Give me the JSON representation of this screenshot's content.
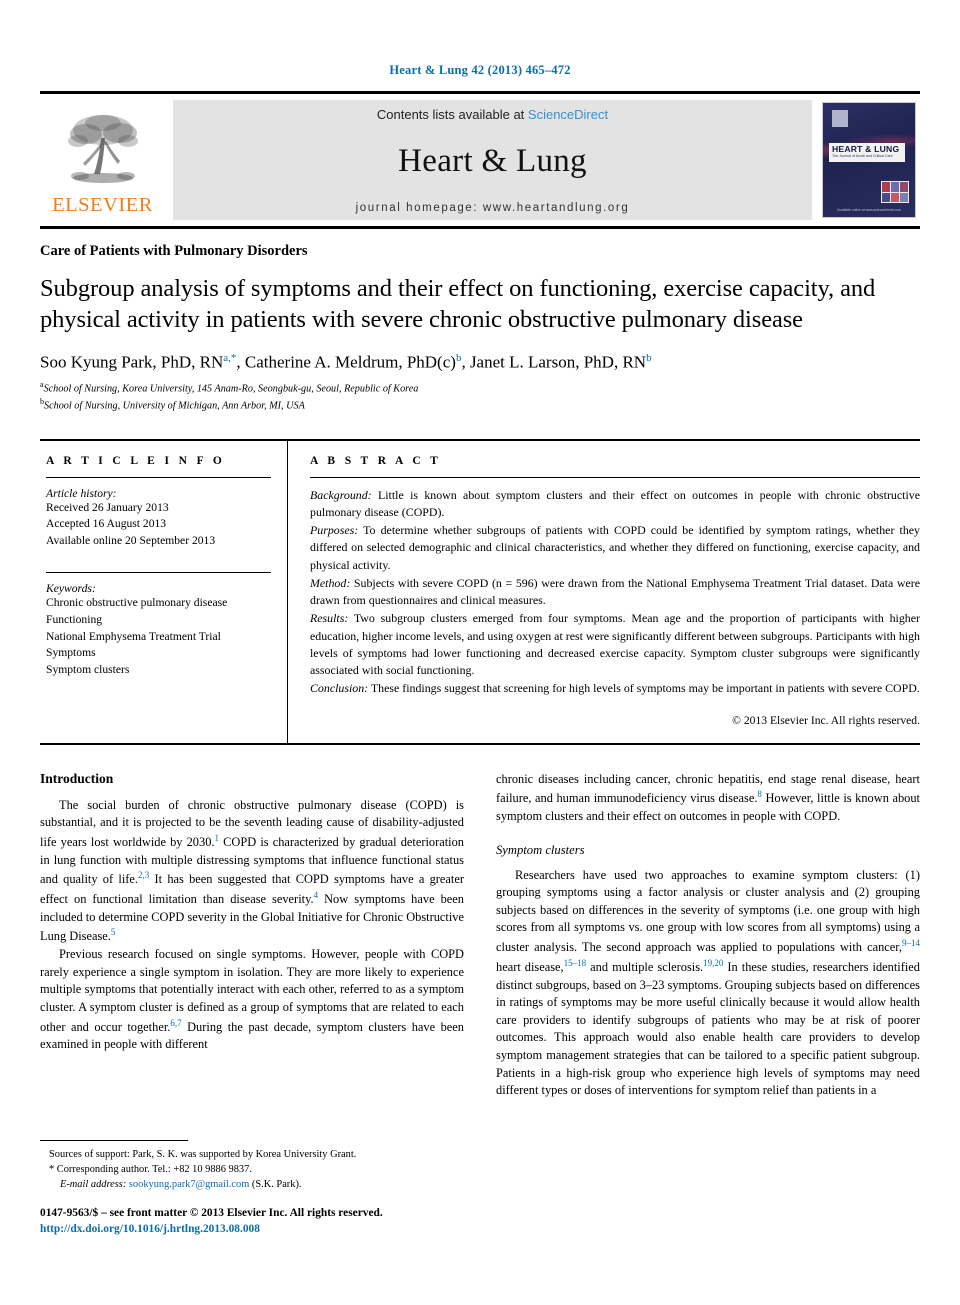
{
  "running_head": "Heart & Lung 42 (2013) 465–472",
  "masthead": {
    "publisher_name": "ELSEVIER",
    "contents_prefix": "Contents lists available at ",
    "sciencedirect": "ScienceDirect",
    "journal_title": "Heart & Lung",
    "homepage": "journal homepage: www.heartandlung.org",
    "cover": {
      "title": "HEART & LUNG",
      "subtitle": "The Journal of Acute and Critical Care",
      "footer": "Available online at www.sciencedirect.com"
    }
  },
  "section_label": "Care of Patients with Pulmonary Disorders",
  "article_title": "Subgroup analysis of symptoms and their effect on functioning, exercise capacity, and physical activity in patients with severe chronic obstructive pulmonary disease",
  "authors": [
    {
      "name": "Soo Kyung Park, PhD, RN",
      "marks": "a,*"
    },
    {
      "name": "Catherine A. Meldrum, PhD(c)",
      "marks": "b"
    },
    {
      "name": "Janet L. Larson, PhD, RN",
      "marks": "b"
    }
  ],
  "affiliations": [
    {
      "mark": "a",
      "text": "School of Nursing, Korea University, 145 Anam-Ro, Seongbuk-gu, Seoul, Republic of Korea"
    },
    {
      "mark": "b",
      "text": "School of Nursing, University of Michigan, Ann Arbor, MI, USA"
    }
  ],
  "article_info": {
    "heading": "A R T I C L E  I N F O",
    "history_label": "Article history:",
    "history": [
      "Received 26 January 2013",
      "Accepted 16 August 2013",
      "Available online 20 September 2013"
    ],
    "keywords_label": "Keywords:",
    "keywords": [
      "Chronic obstructive pulmonary disease",
      "Functioning",
      "National Emphysema Treatment Trial",
      "Symptoms",
      "Symptom clusters"
    ]
  },
  "abstract": {
    "heading": "A B S T R A C T",
    "sections": [
      {
        "label": "Background:",
        "text": " Little is known about symptom clusters and their effect on outcomes in people with chronic obstructive pulmonary disease (COPD)."
      },
      {
        "label": "Purposes:",
        "text": " To determine whether subgroups of patients with COPD could be identified by symptom ratings, whether they differed on selected demographic and clinical characteristics, and whether they differed on functioning, exercise capacity, and physical activity."
      },
      {
        "label": "Method:",
        "text": " Subjects with severe COPD (n = 596) were drawn from the National Emphysema Treatment Trial dataset. Data were drawn from questionnaires and clinical measures."
      },
      {
        "label": "Results:",
        "text": " Two subgroup clusters emerged from four symptoms. Mean age and the proportion of participants with higher education, higher income levels, and using oxygen at rest were significantly different between subgroups. Participants with high levels of symptoms had lower functioning and decreased exercise capacity. Symptom cluster subgroups were significantly associated with social functioning."
      },
      {
        "label": "Conclusion:",
        "text": " These findings suggest that screening for high levels of symptoms may be important in patients with severe COPD."
      }
    ],
    "copyright": "© 2013 Elsevier Inc. All rights reserved."
  },
  "body": {
    "left_column": {
      "heading": "Introduction",
      "paragraph1_a": "The social burden of chronic obstructive pulmonary disease (COPD) is substantial, and it is projected to be the seventh leading cause of disability-adjusted life years lost worldwide by 2030.",
      "ref1": "1",
      "paragraph1_b": " COPD is characterized by gradual deterioration in lung function with multiple distressing symptoms that influence functional status and quality of life.",
      "ref2": "2,3",
      "paragraph1_c": " It has been suggested that COPD symptoms have a greater effect on functional limitation than disease severity.",
      "ref3": "4",
      "paragraph1_d": " Now symptoms have been included to determine COPD severity in the Global Initiative for Chronic Obstructive Lung Disease.",
      "ref4": "5",
      "paragraph2_a": "Previous research focused on single symptoms. However, people with COPD rarely experience a single symptom in isolation. They are more likely to experience multiple symptoms that potentially interact with each other, referred to as a symptom cluster. A symptom cluster is defined as a group of symptoms that are related to each other and occur together.",
      "ref5": "6,7",
      "paragraph2_b": " During the past decade, symptom clusters have been examined in people with different"
    },
    "right_column": {
      "paragraph1_a": "chronic diseases including cancer, chronic hepatitis, end stage renal disease, heart failure, and human immunodeficiency virus disease.",
      "ref1": "8",
      "paragraph1_b": " However, little is known about symptom clusters and their effect on outcomes in people with COPD.",
      "subheading": "Symptom clusters",
      "paragraph2_a": "Researchers have used two approaches to examine symptom clusters: (1) grouping symptoms using a factor analysis or cluster analysis and (2) grouping subjects based on differences in the severity of symptoms (i.e. one group with high scores from all symptoms vs. one group with low scores from all symptoms) using a cluster analysis. The second approach was applied to populations with cancer,",
      "ref2": "9–14",
      "paragraph2_b": " heart disease,",
      "ref3": "15–18",
      "paragraph2_c": " and multiple sclerosis.",
      "ref4": "19,20",
      "paragraph2_d": " In these studies, researchers identified distinct subgroups, based on 3–23 symptoms. Grouping subjects based on differences in ratings of symptoms may be more useful clinically because it would allow health care providers to identify subgroups of patients who may be at risk of poorer outcomes. This approach would also enable health care providers to develop symptom management strategies that can be tailored to a specific patient subgroup. Patients in a high-risk group who experience high levels of symptoms may need different types or doses of interventions for symptom relief than patients in a"
    }
  },
  "footnotes": {
    "support": "Sources of support: Park, S. K. was supported by Korea University Grant.",
    "corresponding": "* Corresponding author. Tel.: +82 10 9886 9837.",
    "email_label": "E-mail address:",
    "email": "sookyung.park7@gmail.com",
    "email_suffix": " (S.K. Park)."
  },
  "imprint": {
    "line": "0147-9563/$ – see front matter © 2013 Elsevier Inc. All rights reserved.",
    "doi": "http://dx.doi.org/10.1016/j.hrtlng.2013.08.008"
  }
}
